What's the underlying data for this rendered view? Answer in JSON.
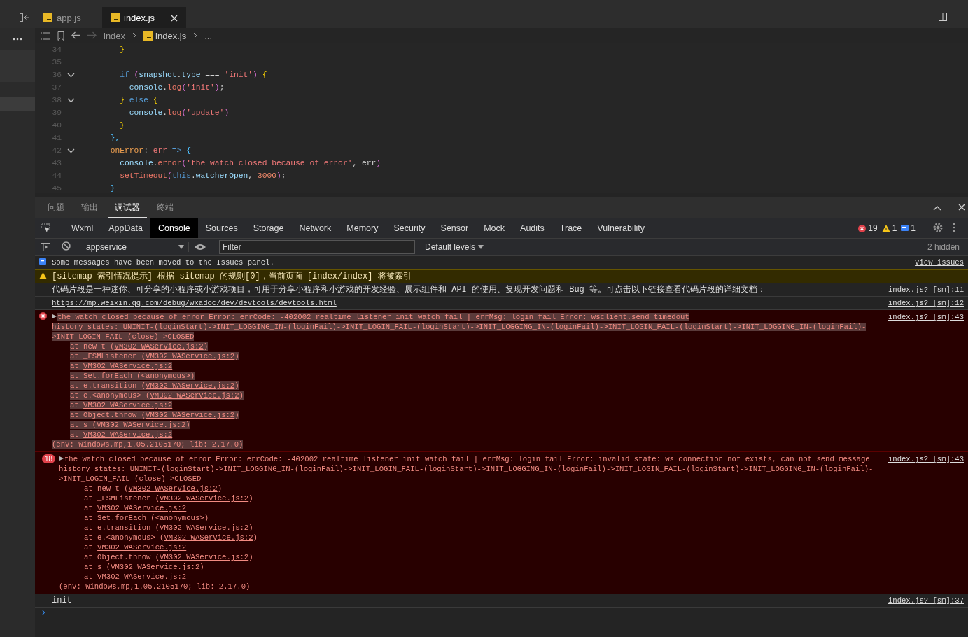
{
  "editor_tabs": [
    {
      "label": "app.js",
      "selected": false
    },
    {
      "label": "index.js",
      "selected": true
    }
  ],
  "breadcrumb": {
    "back_disabled": false,
    "forward_disabled": true,
    "items": [
      {
        "label": "index",
        "file": false
      },
      {
        "label": "index.js",
        "file": true
      },
      {
        "label": "...",
        "file": false
      }
    ]
  },
  "code_lines": [
    {
      "number": "34",
      "foldable": false,
      "tokens": [
        {
          "kind": "brace",
          "text": "        }"
        }
      ]
    },
    {
      "number": "35",
      "foldable": false
    },
    {
      "number": "36",
      "foldable": true,
      "tokens": [
        {
          "kind": "kw",
          "text": "        if "
        },
        {
          "kind": "paren",
          "text": "("
        },
        {
          "kind": "var",
          "text": "snapshot"
        },
        {
          "kind": "plain",
          "text": "."
        },
        {
          "kind": "var",
          "text": "type"
        },
        {
          "kind": "plain",
          "text": " === "
        },
        {
          "kind": "str",
          "text": "'init'"
        },
        {
          "kind": "paren",
          "text": ")"
        },
        {
          "kind": "brace",
          "text": " {"
        }
      ]
    },
    {
      "number": "37",
      "foldable": false,
      "tokens": [
        {
          "kind": "var",
          "text": "          console"
        },
        {
          "kind": "plain",
          "text": "."
        },
        {
          "kind": "fn",
          "text": "log"
        },
        {
          "kind": "paren",
          "text": "("
        },
        {
          "kind": "str",
          "text": "'init'"
        },
        {
          "kind": "paren",
          "text": ")"
        },
        {
          "kind": "plain",
          "text": ";"
        }
      ]
    },
    {
      "number": "38",
      "foldable": true,
      "tokens": [
        {
          "kind": "brace",
          "text": "        } "
        },
        {
          "kind": "kw",
          "text": "else "
        },
        {
          "kind": "brace",
          "text": "{"
        }
      ]
    },
    {
      "number": "39",
      "foldable": false,
      "tokens": [
        {
          "kind": "var",
          "text": "          console"
        },
        {
          "kind": "plain",
          "text": "."
        },
        {
          "kind": "fn",
          "text": "log"
        },
        {
          "kind": "paren",
          "text": "("
        },
        {
          "kind": "str",
          "text": "'update'"
        },
        {
          "kind": "paren",
          "text": ")"
        }
      ]
    },
    {
      "number": "40",
      "foldable": false,
      "tokens": [
        {
          "kind": "brace",
          "text": "        }"
        }
      ]
    },
    {
      "number": "41",
      "foldable": false,
      "tokens": [
        {
          "kind": "bracket",
          "text": "      },"
        }
      ]
    },
    {
      "number": "42",
      "foldable": true,
      "tokens": [
        {
          "kind": "prop",
          "text": "      onError"
        },
        {
          "kind": "plain",
          "text": ": "
        },
        {
          "kind": "param",
          "text": "err "
        },
        {
          "kind": "kw",
          "text": "=> "
        },
        {
          "kind": "bracket",
          "text": "{"
        }
      ]
    },
    {
      "number": "43",
      "foldable": false,
      "tokens": [
        {
          "kind": "var",
          "text": "        console"
        },
        {
          "kind": "plain",
          "text": "."
        },
        {
          "kind": "fn",
          "text": "error"
        },
        {
          "kind": "paren",
          "text": "("
        },
        {
          "kind": "str",
          "text": "'the watch closed because of error'"
        },
        {
          "kind": "plain",
          "text": ", err"
        },
        {
          "kind": "paren",
          "text": ")"
        }
      ]
    },
    {
      "number": "44",
      "foldable": false,
      "tokens": [
        {
          "kind": "fn",
          "text": "        setTimeout"
        },
        {
          "kind": "paren",
          "text": "("
        },
        {
          "kind": "kw",
          "text": "this"
        },
        {
          "kind": "plain",
          "text": "."
        },
        {
          "kind": "var",
          "text": "watcherOpen"
        },
        {
          "kind": "plain",
          "text": ", "
        },
        {
          "kind": "num",
          "text": "3000"
        },
        {
          "kind": "paren",
          "text": ")"
        },
        {
          "kind": "plain",
          "text": ";"
        }
      ]
    },
    {
      "number": "45",
      "foldable": false,
      "tokens": [
        {
          "kind": "bracket",
          "text": "      }"
        }
      ]
    }
  ],
  "panel_tabs": [
    {
      "label": "问题",
      "selected": false
    },
    {
      "label": "输出",
      "selected": false
    },
    {
      "label": "调试器",
      "selected": true
    },
    {
      "label": "终端",
      "selected": false
    }
  ],
  "devtools_tabs": [
    {
      "label": "Wxml",
      "selected": false
    },
    {
      "label": "AppData",
      "selected": false
    },
    {
      "label": "Console",
      "selected": true
    },
    {
      "label": "Sources",
      "selected": false
    },
    {
      "label": "Storage",
      "selected": false
    },
    {
      "label": "Network",
      "selected": false
    },
    {
      "label": "Memory",
      "selected": false
    },
    {
      "label": "Security",
      "selected": false
    },
    {
      "label": "Sensor",
      "selected": false
    },
    {
      "label": "Mock",
      "selected": false
    },
    {
      "label": "Audits",
      "selected": false
    },
    {
      "label": "Trace",
      "selected": false
    },
    {
      "label": "Vulnerability",
      "selected": false
    }
  ],
  "counts": {
    "errors": "19",
    "warnings": "1",
    "info": "1"
  },
  "console_toolbar": {
    "context": "appservice",
    "filter_placeholder": "Filter",
    "levels": "Default levels",
    "hidden": "2 hidden"
  },
  "messages": [
    {
      "kind": "info",
      "text": "Some messages have been moved to the Issues panel.",
      "source": "View issues"
    },
    {
      "kind": "warning",
      "text": "[sitemap 索引情况提示] 根据 sitemap 的规则[0]，当前页面 [index/index] 将被索引"
    },
    {
      "kind": "log",
      "text": "代码片段是一种迷你、可分享的小程序或小游戏项目，可用于分享小程序和小游戏的开发经验、展示组件和 API 的使用、复现开发问题和 Bug 等。可点击以下链接查看代码片段的详细文档：",
      "source": "index.js? [sm]:11"
    },
    {
      "kind": "url",
      "text": "https://mp.weixin.qq.com/debug/wxadoc/dev/devtools/devtools.html",
      "source": "index.js? [sm]:12"
    },
    {
      "kind": "error",
      "selected": true,
      "source": "index.js? [sm]:43",
      "header": "the watch closed because of error Error: errCode: -402002 realtime listener init watch fail | errMsg: login fail Error: wsclient.send timedout",
      "history": [
        "history states: UNINIT-(loginStart)->INIT_LOGGING_IN-(loginFail)->INIT_LOGIN_FAIL-(loginStart)->INIT_LOGGING_IN-(loginFail)->INIT_LOGIN_FAIL-(loginStart)->INIT_LOGGING_IN-(loginFail)-",
        ">INIT_LOGIN_FAIL-(close)->CLOSED"
      ],
      "frames": [
        {
          "text": "at new t (",
          "link": "VM302 WAService.js:2",
          "tail": ")"
        },
        {
          "text": "at _FSMListener (",
          "link": "VM302 WAService.js:2",
          "tail": ")"
        },
        {
          "text": "at ",
          "link": "VM302 WAService.js:2"
        },
        {
          "text": "at Set.forEach (<anonymous>)"
        },
        {
          "text": "at e.transition (",
          "link": "VM302 WAService.js:2",
          "tail": ")"
        },
        {
          "text": "at e.<anonymous> (",
          "link": "VM302 WAService.js:2",
          "tail": ")"
        },
        {
          "text": "at ",
          "link": "VM302 WAService.js:2"
        },
        {
          "text": "at Object.throw (",
          "link": "VM302 WAService.js:2",
          "tail": ")"
        },
        {
          "text": "at s (",
          "link": "VM302 WAService.js:2",
          "tail": ")"
        },
        {
          "text": "at ",
          "link": "VM302 WAService.js:2"
        }
      ],
      "env": "(env: Windows,mp,1.05.2105170; lib: 2.17.0)"
    },
    {
      "kind": "error",
      "selected": false,
      "count": "18",
      "source": "index.js? [sm]:43",
      "header": "the watch closed because of error Error: errCode: -402002 realtime listener init watch fail | errMsg: login fail Error: invalid state: ws connection not exists, can not send message",
      "history": [
        "history states: UNINIT-(loginStart)->INIT_LOGGING_IN-(loginFail)->INIT_LOGIN_FAIL-(loginStart)->INIT_LOGGING_IN-(loginFail)->INIT_LOGIN_FAIL-(loginStart)->INIT_LOGGING_IN-(loginFail)-",
        ">INIT_LOGIN_FAIL-(close)->CLOSED"
      ],
      "frames": [
        {
          "text": "at new t (",
          "link": "VM302 WAService.js:2",
          "tail": ")"
        },
        {
          "text": "at _FSMListener (",
          "link": "VM302 WAService.js:2",
          "tail": ")"
        },
        {
          "text": "at ",
          "link": "VM302 WAService.js:2"
        },
        {
          "text": "at Set.forEach (<anonymous>)"
        },
        {
          "text": "at e.transition (",
          "link": "VM302 WAService.js:2",
          "tail": ")"
        },
        {
          "text": "at e.<anonymous> (",
          "link": "VM302 WAService.js:2",
          "tail": ")"
        },
        {
          "text": "at ",
          "link": "VM302 WAService.js:2"
        },
        {
          "text": "at Object.throw (",
          "link": "VM302 WAService.js:2",
          "tail": ")"
        },
        {
          "text": "at s (",
          "link": "VM302 WAService.js:2",
          "tail": ")"
        },
        {
          "text": "at ",
          "link": "VM302 WAService.js:2"
        }
      ],
      "env": "(env: Windows,mp,1.05.2105170; lib: 2.17.0)"
    },
    {
      "kind": "log",
      "text": "init",
      "source": "index.js? [sm]:37"
    }
  ],
  "prompt": "›"
}
